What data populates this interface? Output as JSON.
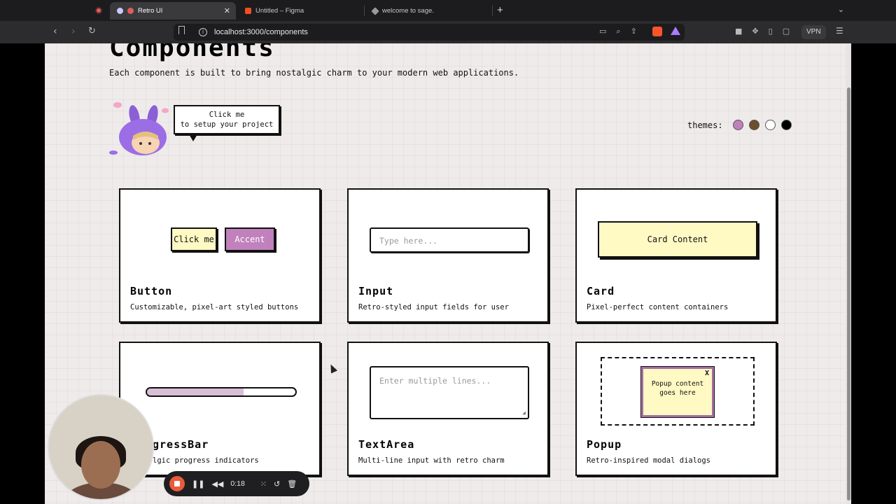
{
  "browser": {
    "tabs": [
      {
        "label": "Retro UI",
        "active": true
      },
      {
        "label": "Untitled – Figma",
        "active": false
      },
      {
        "label": "welcome to sage.",
        "active": false
      }
    ],
    "url": "localhost:3000/components",
    "vpn_label": "VPN"
  },
  "page": {
    "title": "Components",
    "subtitle": "Each component is built to bring nostalgic charm to your modern web applications.",
    "bubble_line1": "Click me",
    "bubble_line2": "to setup your project",
    "themes_label": "themes:",
    "theme_colors": [
      "#c081bd",
      "#6b4e2a",
      "#ffffff",
      "#000000"
    ]
  },
  "cards": [
    {
      "title": "Button",
      "desc": "Customizable, pixel-art styled buttons",
      "demo_primary": "Click me",
      "demo_accent": "Accent"
    },
    {
      "title": "Input",
      "desc": "Retro-styled input fields for user",
      "placeholder": "Type here..."
    },
    {
      "title": "Card",
      "desc": "Pixel-perfect content containers",
      "content": "Card Content"
    },
    {
      "title": "ProgressBar",
      "title_visible": "gressBar",
      "desc_visible": "lgic progress indicators",
      "progress": 0.65
    },
    {
      "title": "TextArea",
      "desc": "Multi-line input with retro charm",
      "placeholder": "Enter multiple lines..."
    },
    {
      "title": "Popup",
      "desc": "Retro-inspired modal dialogs",
      "popup_text": "Popup content goes here",
      "close": "X"
    }
  ],
  "recording": {
    "time": "0:18"
  },
  "colors": {
    "accent": "#c081bd",
    "card_bg": "#fff9c4",
    "page_bg": "#efebea"
  }
}
